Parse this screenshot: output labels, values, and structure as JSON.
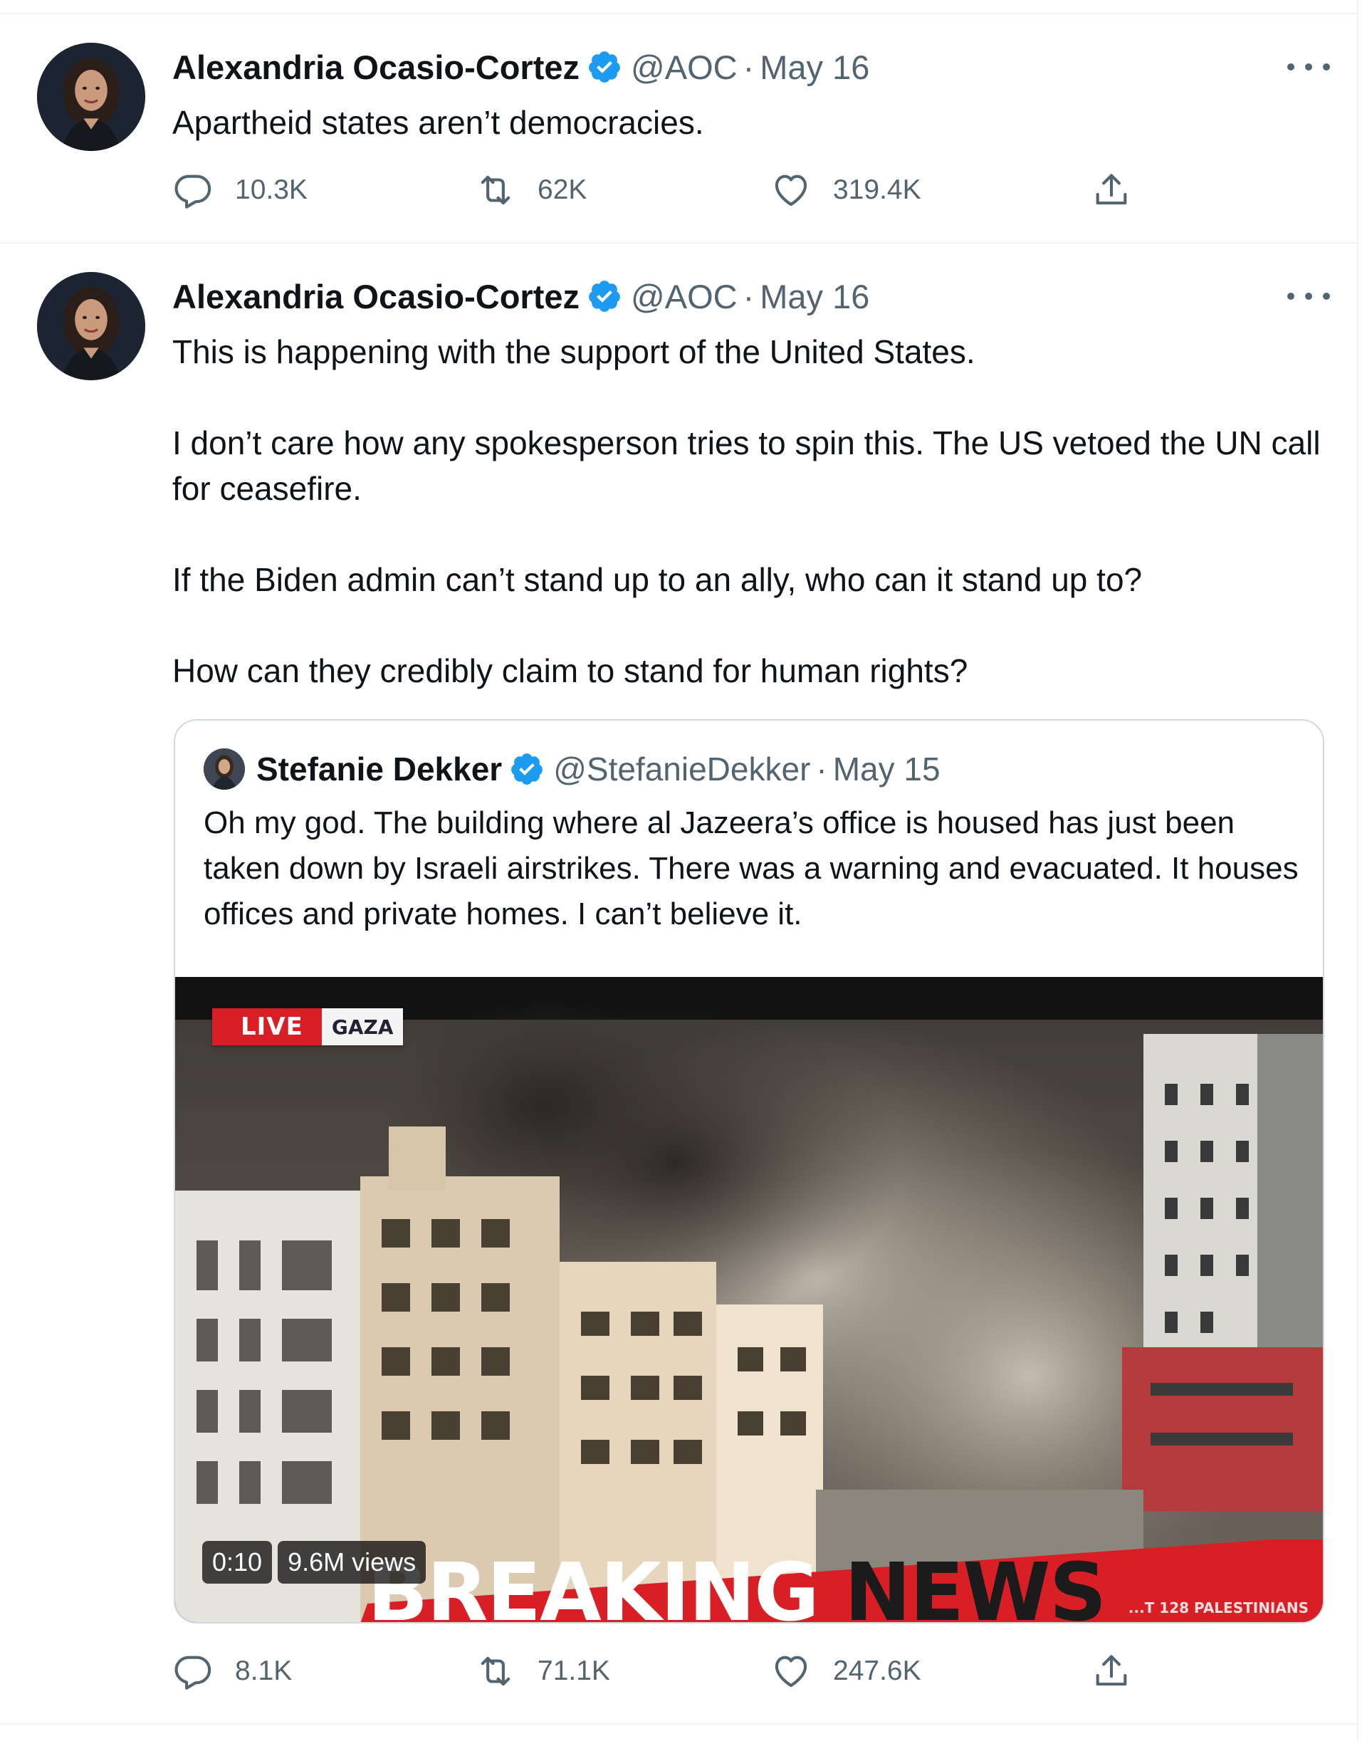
{
  "tweets": [
    {
      "author_name": "Alexandria Ocasio-Cortez",
      "handle": "@AOC",
      "separator": "·",
      "date": "May 16",
      "text": [
        "Apartheid states aren’t democracies."
      ],
      "stats": {
        "replies": "10.3K",
        "retweets": "62K",
        "likes": "319.4K"
      }
    },
    {
      "author_name": "Alexandria Ocasio-Cortez",
      "handle": "@AOC",
      "separator": "·",
      "date": "May 16",
      "text": [
        "This is happening with the support of the United States.",
        "I don’t care how any spokesperson tries to spin this. The US vetoed the UN call for ceasefire.",
        "If the Biden admin can’t stand up to an ally, who can it stand up to?",
        "How can they credibly claim to stand for human rights?"
      ],
      "quote": {
        "author_name": "Stefanie Dekker",
        "handle": "@StefanieDekker",
        "separator": "·",
        "date": "May 15",
        "text": "Oh my god. The building where al Jazeera’s office is housed has just been taken down by Israeli airstrikes. There was a warning and evacuated. It houses offices and private homes. I can’t believe it.",
        "video": {
          "duration": "0:10",
          "views": "9.6M views",
          "overlay_live": "LIVE",
          "overlay_location": "GAZA",
          "overlay_breaking": "BREAKING",
          "overlay_news": "NEWS",
          "overlay_ticker": "...T 128 PALESTINIANS"
        }
      },
      "stats": {
        "replies": "8.1K",
        "retweets": "71.1K",
        "likes": "247.6K"
      }
    }
  ],
  "icons": {
    "verified": "verified-badge-icon",
    "more": "more-options-icon",
    "reply": "reply-icon",
    "retweet": "retweet-icon",
    "like": "heart-icon",
    "share": "share-icon"
  },
  "colors": {
    "primary_text": "#0f1419",
    "secondary_text": "#536471",
    "verified_blue": "#1d9bf0",
    "divider": "#eff3f4",
    "quote_border": "#cfd9de",
    "live_red": "#d81f26"
  }
}
